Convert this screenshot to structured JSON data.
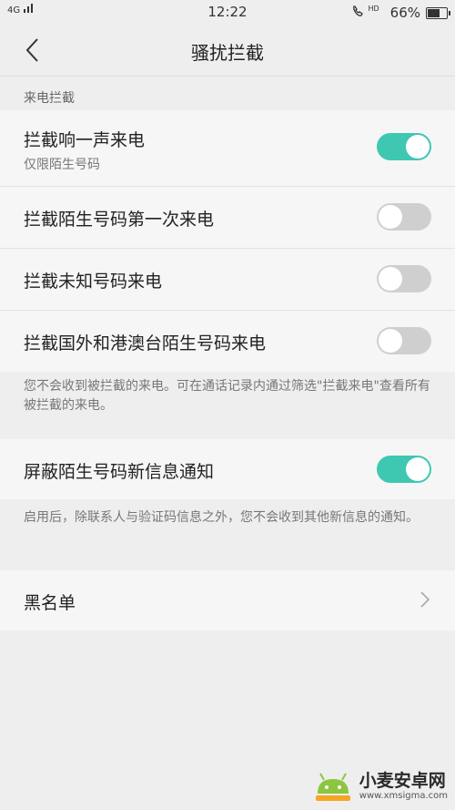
{
  "status_bar": {
    "network": "4G",
    "time": "12:22",
    "hd_label": "HD",
    "battery": "66%",
    "battery_level": 0.66
  },
  "nav": {
    "title": "骚扰拦截",
    "back_icon": "chevron-left-icon"
  },
  "section_call": {
    "header": "来电拦截",
    "rows": [
      {
        "label": "拦截响一声来电",
        "sub": "仅限陌生号码",
        "on": true
      },
      {
        "label": "拦截陌生号码第一次来电",
        "on": false
      },
      {
        "label": "拦截未知号码来电",
        "on": false
      },
      {
        "label": "拦截国外和港澳台陌生号码来电",
        "on": false
      }
    ],
    "note": "您不会收到被拦截的来电。可在通话记录内通过筛选\"拦截来电\"查看所有被拦截的来电。"
  },
  "section_sms": {
    "row": {
      "label": "屏蔽陌生号码新信息通知",
      "on": true
    },
    "note": "启用后，除联系人与验证码信息之外，您不会收到其他新信息的通知。"
  },
  "blacklist": {
    "label": "黑名单",
    "icon": "chevron-right-icon"
  },
  "watermark": {
    "title": "小麦安卓网",
    "url": "www.xmsigma.com"
  },
  "colors": {
    "accent": "#3ec8b2",
    "toggle_off": "#cfcfcf",
    "background": "#eeeeee",
    "card": "#f6f6f6"
  }
}
